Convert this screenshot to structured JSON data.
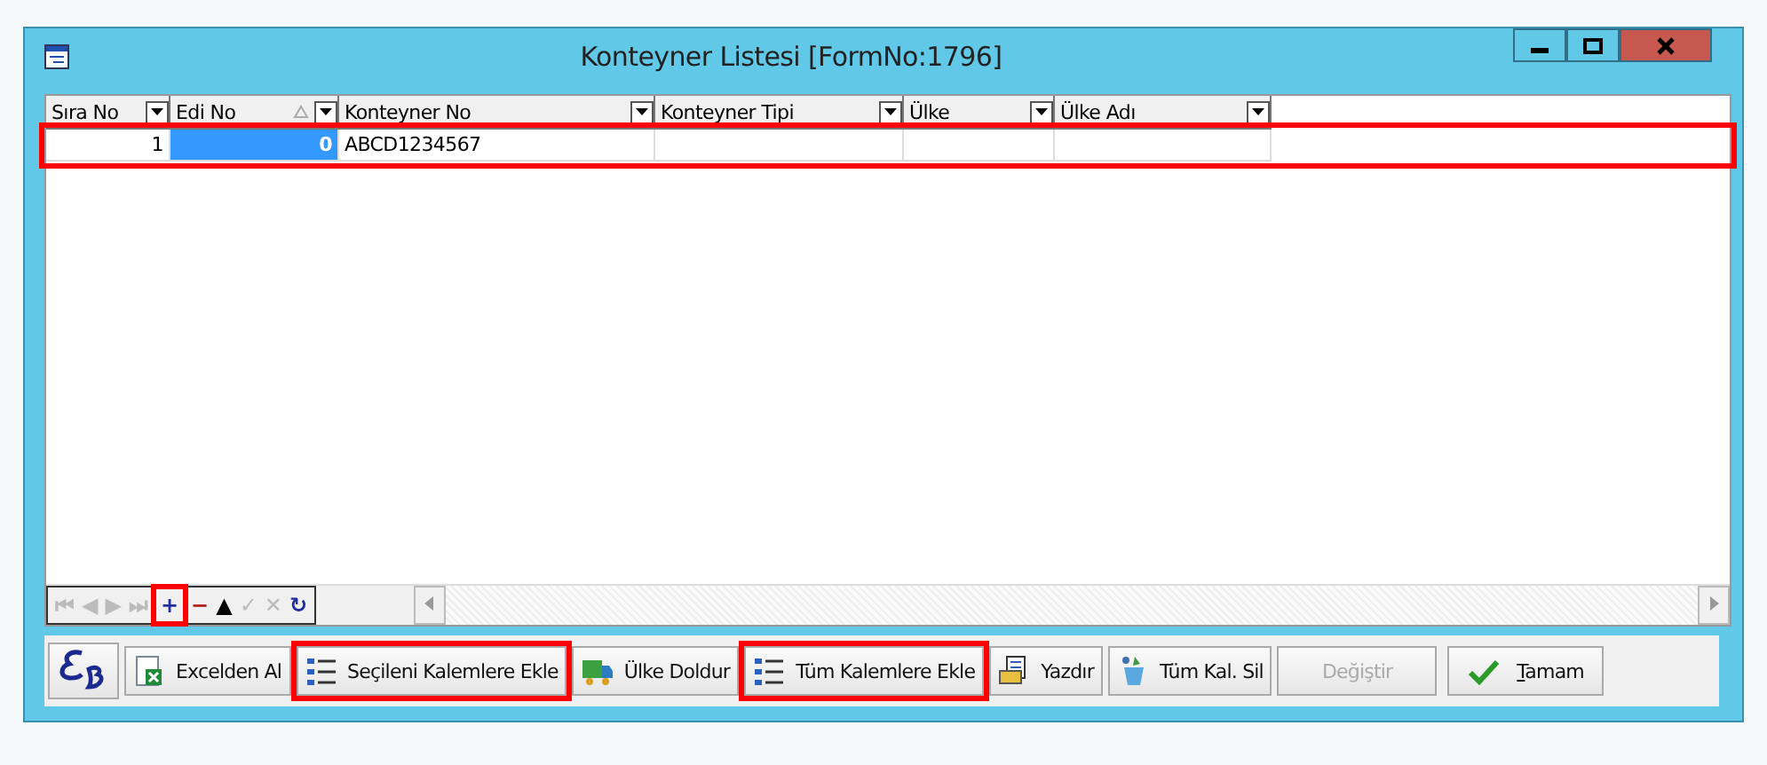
{
  "window": {
    "title": "Konteyner Listesi [FormNo:1796]"
  },
  "table": {
    "columns": [
      {
        "label": "Sıra No",
        "sorted": false
      },
      {
        "label": "Edi No",
        "sorted": true
      },
      {
        "label": "Konteyner No",
        "sorted": false
      },
      {
        "label": "Konteyner Tipi",
        "sorted": false
      },
      {
        "label": "Ülke",
        "sorted": false
      },
      {
        "label": "Ülke Adı",
        "sorted": false
      }
    ],
    "rows": [
      {
        "cells": [
          {
            "value": "1",
            "focused": false
          },
          {
            "value": "0",
            "focused": true
          },
          {
            "value": "ABCD1234567",
            "focused": false
          },
          {
            "focused": false
          },
          {
            "focused": false
          },
          {
            "focused": false
          }
        ],
        "highlighted": true
      }
    ]
  },
  "navigator": [
    {
      "kind": "first",
      "label": "⏮",
      "disabled": true,
      "highlighted": false
    },
    {
      "kind": "prev",
      "label": "◀",
      "disabled": true,
      "highlighted": false
    },
    {
      "kind": "next",
      "label": "▶",
      "disabled": true,
      "highlighted": false
    },
    {
      "kind": "last",
      "label": "⏭",
      "disabled": true,
      "highlighted": false
    },
    {
      "kind": "insert",
      "label": "+",
      "disabled": false,
      "highlighted": true
    },
    {
      "kind": "delete",
      "label": "−",
      "disabled": false,
      "highlighted": false
    },
    {
      "kind": "edit",
      "label": "▲",
      "disabled": false,
      "highlighted": false
    },
    {
      "kind": "post",
      "label": "✓",
      "disabled": true,
      "highlighted": false
    },
    {
      "kind": "cancel",
      "label": "✕",
      "disabled": true,
      "highlighted": false
    },
    {
      "kind": "refresh",
      "label": "↻",
      "disabled": false,
      "highlighted": false
    }
  ],
  "buttons": [
    {
      "kind": "logo",
      "disabled": false,
      "highlighted": false
    },
    {
      "kind": "excel",
      "label": "Excelden Al",
      "disabled": false,
      "highlighted": false
    },
    {
      "kind": "list",
      "label": "Seçileni Kalemlere Ekle",
      "disabled": false,
      "highlighted": true
    },
    {
      "kind": "truck",
      "label": "Ülke Doldur",
      "disabled": false,
      "highlighted": false
    },
    {
      "kind": "list",
      "label": "Tüm Kalemlere Ekle",
      "disabled": false,
      "highlighted": true
    },
    {
      "kind": "print",
      "label": "Yazdır",
      "disabled": false,
      "highlighted": false
    },
    {
      "kind": "recycle",
      "label": "Tüm Kal. Sil",
      "disabled": false,
      "highlighted": false
    },
    {
      "kind": "plain",
      "label": "Değiştir",
      "disabled": true,
      "highlighted": false
    },
    {
      "kind": "ok",
      "label": "Tamam",
      "disabled": false,
      "highlighted": false
    }
  ]
}
